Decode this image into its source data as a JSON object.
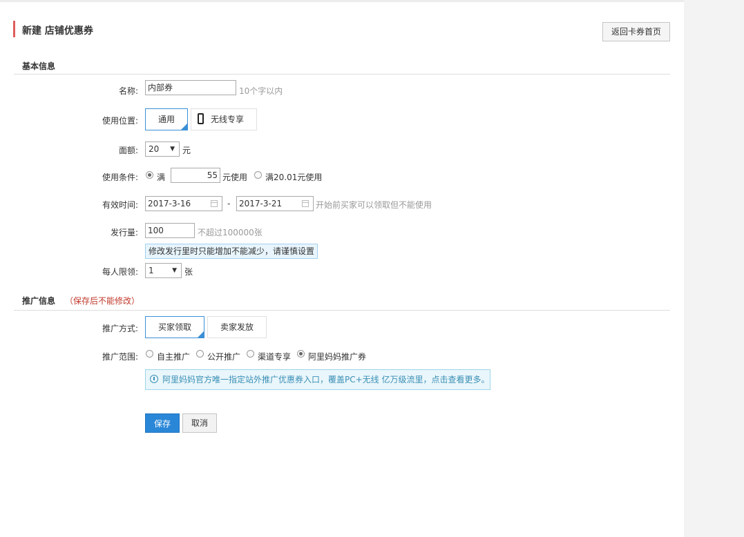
{
  "header": {
    "title": "新建 店铺优惠券",
    "back_button": "返回卡券首页"
  },
  "basic_section": {
    "title": "基本信息"
  },
  "form": {
    "name": {
      "label": "名称:",
      "value": "内部券",
      "hint": "10个字以内"
    },
    "location": {
      "label": "使用位置:",
      "options": [
        "通用",
        "无线专享"
      ],
      "selected": "通用"
    },
    "denomination": {
      "label": "面额:",
      "value": "20",
      "unit": "元"
    },
    "condition": {
      "label": "使用条件:",
      "prefix": "满",
      "value": "55",
      "suffix": "元使用",
      "alt_option": "满20.01元使用",
      "selected": "prefix"
    },
    "validity": {
      "label": "有效时间:",
      "start": "2017-3-16",
      "separator": "-",
      "end": "2017-3-21",
      "hint": "开始前买家可以领取但不能使用"
    },
    "quantity": {
      "label": "发行量:",
      "value": "100",
      "hint": "不超过100000张",
      "tip": "修改发行里时只能增加不能减少，请谨慎设置"
    },
    "limit": {
      "label": "每人限领:",
      "value": "1",
      "unit": "张"
    }
  },
  "promo_section": {
    "title": "推广信息",
    "note": "（保存后不能修改）"
  },
  "promo": {
    "method": {
      "label": "推广方式:",
      "options": [
        "买家领取",
        "卖家发放"
      ],
      "selected": "买家领取"
    },
    "scope": {
      "label": "推广范围:",
      "options": [
        "自主推广",
        "公开推广",
        "渠道专享",
        "阿里妈妈推广券"
      ],
      "selected": "阿里妈妈推广券"
    },
    "info": "阿里妈妈官方唯一指定站外推广优惠券入口，覆盖PC+无线 亿万级流里，点击查看更多。"
  },
  "actions": {
    "save": "保存",
    "cancel": "取消"
  },
  "colors": {
    "accent": "#2a87d7",
    "title_bar": "#e05b5b",
    "note": "#c0392b"
  }
}
